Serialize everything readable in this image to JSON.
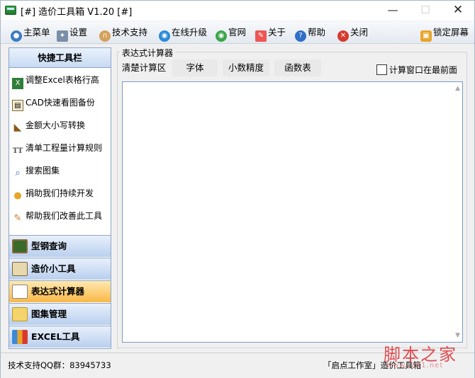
{
  "window": {
    "title": "[#] 造价工具箱 V1.20 [#]"
  },
  "toolbar": {
    "main_menu": "主菜单",
    "settings": "设置",
    "tech_support": "技术支持",
    "online_upgrade": "在线升级",
    "official_site": "官网",
    "about": "关于",
    "help": "帮助",
    "close": "关闭",
    "lock_screen": "锁定屏幕"
  },
  "sidebar": {
    "header": "快捷工具栏",
    "items": [
      {
        "label": "调整Excel表格行高",
        "icon": "excel-icon"
      },
      {
        "label": "CAD快速看图备份",
        "icon": "cad-icon"
      },
      {
        "label": "金额大小写转换",
        "icon": "ruler-icon"
      },
      {
        "label": "清单工程量计算规则",
        "icon": "tt-icon"
      },
      {
        "label": "搜索图集",
        "icon": "search-icon"
      },
      {
        "label": "捐助我们持续开发",
        "icon": "medal-icon"
      },
      {
        "label": "帮助我们改善此工具",
        "icon": "edit-icon"
      }
    ],
    "categories": [
      {
        "label": "型钢查询",
        "active": false
      },
      {
        "label": "造价小工具",
        "active": false
      },
      {
        "label": "表达式计算器",
        "active": true
      },
      {
        "label": "图集管理",
        "active": false
      },
      {
        "label": "EXCEL工具",
        "active": false
      }
    ]
  },
  "main": {
    "group_title": "表达式计算器",
    "tabs": [
      "清楚计算区",
      "字体",
      "小数精度",
      "函数表"
    ],
    "checkbox_label": "计算窗口在最前面",
    "checkbox_checked": false,
    "expression_text": ""
  },
  "status": {
    "left": "技术支持QQ群：83945733",
    "right": "「启点工作室」造价工具箱"
  },
  "watermark": {
    "text": "脚本之家",
    "sub": "www.jb51.net"
  },
  "colors": {
    "accent": "#1d5fb4",
    "active_category": "#f9b746",
    "watermark": "#e0393e"
  }
}
